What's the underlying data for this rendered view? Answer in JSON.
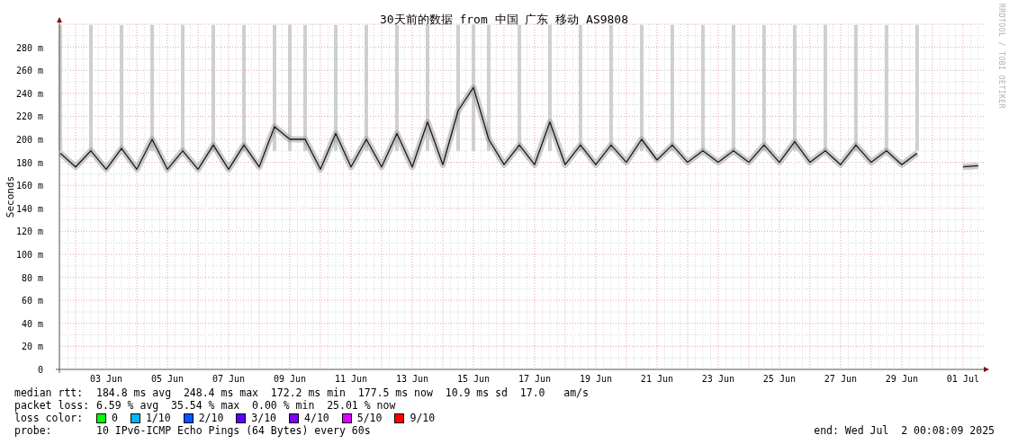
{
  "chart": {
    "chart_data": {
      "type": "line",
      "grid": true,
      "title": "30天前的数据 from 中国 广东 移动 AS9808",
      "ylabel": "Seconds",
      "ylim": [
        0,
        300
      ],
      "categories": [
        null,
        null,
        null,
        "03 Jun",
        null,
        null,
        null,
        "05 Jun",
        null,
        null,
        null,
        "07 Jun",
        null,
        null,
        null,
        "09 Jun",
        null,
        null,
        null,
        "11 Jun",
        null,
        null,
        null,
        "13 Jun",
        null,
        null,
        null,
        "15 Jun",
        null,
        null,
        null,
        "17 Jun",
        null,
        null,
        null,
        "19 Jun",
        null,
        null,
        null,
        "21 Jun",
        null,
        null,
        null,
        "23 Jun",
        null,
        null,
        null,
        "25 Jun",
        null,
        null,
        null,
        "27 Jun",
        null,
        null,
        null,
        "29 Jun",
        null,
        null,
        null,
        "01 Jul",
        null
      ],
      "yticks": [
        {
          "value": 0,
          "label": "0"
        },
        {
          "value": 20,
          "label": "20 m"
        },
        {
          "value": 40,
          "label": "40 m"
        },
        {
          "value": 60,
          "label": "60 m"
        },
        {
          "value": 80,
          "label": "80 m"
        },
        {
          "value": 100,
          "label": "100 m"
        },
        {
          "value": 120,
          "label": "120 m"
        },
        {
          "value": 140,
          "label": "140 m"
        },
        {
          "value": 160,
          "label": "160 m"
        },
        {
          "value": 180,
          "label": "180 m"
        },
        {
          "value": 200,
          "label": "200 m"
        },
        {
          "value": 220,
          "label": "220 m"
        },
        {
          "value": 240,
          "label": "240 m"
        },
        {
          "value": 260,
          "label": "260 m"
        },
        {
          "value": 280,
          "label": "280 m"
        }
      ],
      "series": [
        {
          "color": "#1a1a1a",
          "values": [
            188,
            176,
            190,
            174,
            192,
            174,
            200,
            174,
            190,
            174,
            195,
            174,
            195,
            176,
            211,
            200,
            200,
            174,
            205,
            176,
            200,
            176,
            205,
            176,
            215,
            178,
            225,
            245,
            200,
            178,
            195,
            178,
            215,
            178,
            195,
            178,
            195,
            180,
            200,
            182,
            195,
            180,
            190,
            180,
            190,
            180,
            195,
            180,
            198,
            180,
            190,
            178,
            195,
            180,
            190,
            178,
            188,
            null,
            null,
            176,
            177
          ]
        }
      ]
    },
    "credit": "RRDTOOL / TOBI OETIKER"
  },
  "legend": {
    "rows": [
      {
        "label": "median rtt:",
        "text": "184.8 ms avg  248.4 ms max  172.2 ms min  177.5 ms now  10.9 ms sd  17.0   am/s"
      },
      {
        "label": "packet loss:",
        "text": "6.59 % avg  35.54 % max  0.00 % min  25.01 % now"
      }
    ],
    "loss_color": {
      "label": "loss color:",
      "items": [
        {
          "label": "0",
          "color": "#00ff00"
        },
        {
          "label": "1/10",
          "color": "#00b8ff"
        },
        {
          "label": "2/10",
          "color": "#0059ff"
        },
        {
          "label": "3/10",
          "color": "#5e00ff"
        },
        {
          "label": "4/10",
          "color": "#7e00ff"
        },
        {
          "label": "5/10",
          "color": "#dd00ff"
        },
        {
          "label": "9/10",
          "color": "#ff0000"
        }
      ]
    },
    "probe": {
      "label": "probe:",
      "text": "10 IPv6-ICMP Echo Pings (64 Bytes) every 60s"
    },
    "end": "end: Wed Jul  2 00:08:09 2025"
  }
}
